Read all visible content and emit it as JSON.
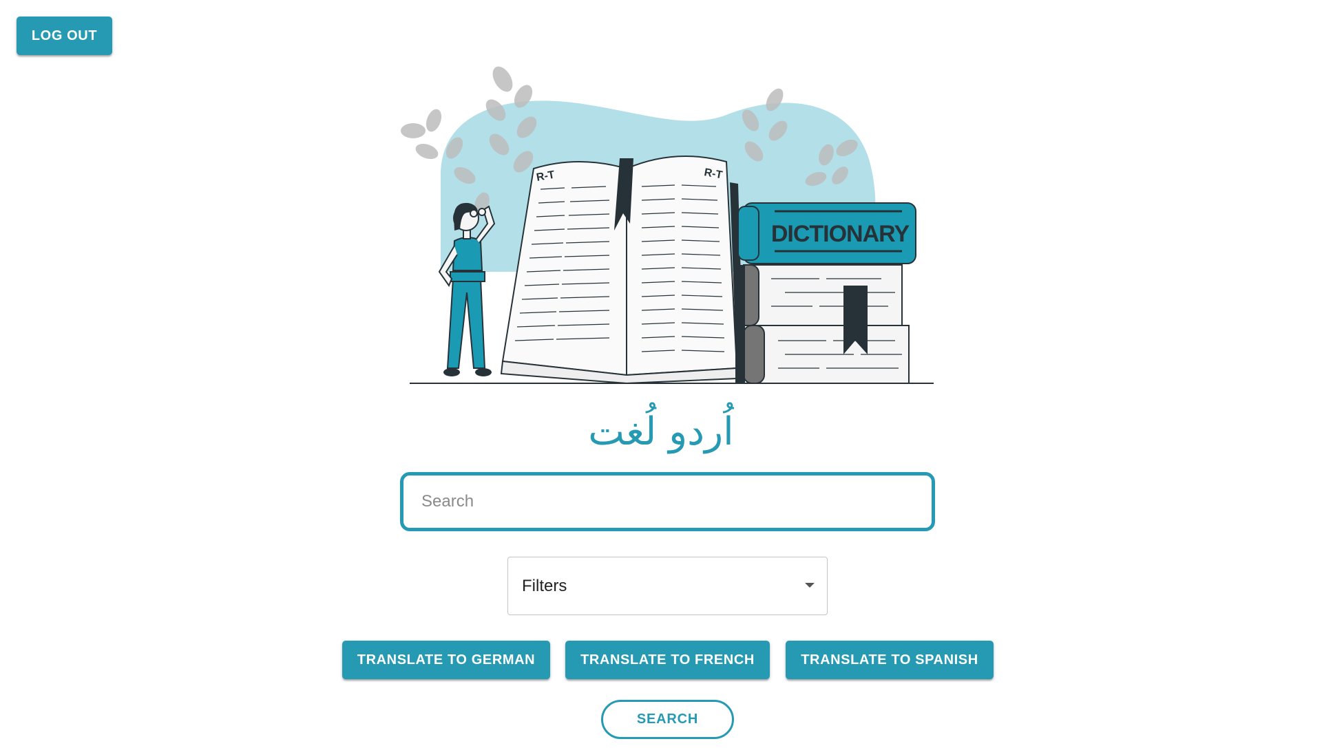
{
  "header": {
    "logout_label": "LOG OUT"
  },
  "illustration": {
    "book_spine_text": "DICTIONARY",
    "page_header_left": "R-T",
    "page_header_right": "R-T",
    "colors": {
      "accent": "#1a9bb3",
      "blob": "#b3dfe8",
      "dark": "#263238",
      "leaf": "#bdbdbd"
    }
  },
  "title": {
    "urdu": "اُردو لُغت"
  },
  "search": {
    "placeholder": "Search",
    "value": ""
  },
  "filters": {
    "label": "Filters"
  },
  "translate_buttons": {
    "german": "TRANSLATE TO GERMAN",
    "french": "TRANSLATE TO FRENCH",
    "spanish": "TRANSLATE TO SPANISH"
  },
  "search_button": {
    "label": "SEARCH"
  },
  "theme": {
    "primary": "#2699b3"
  }
}
